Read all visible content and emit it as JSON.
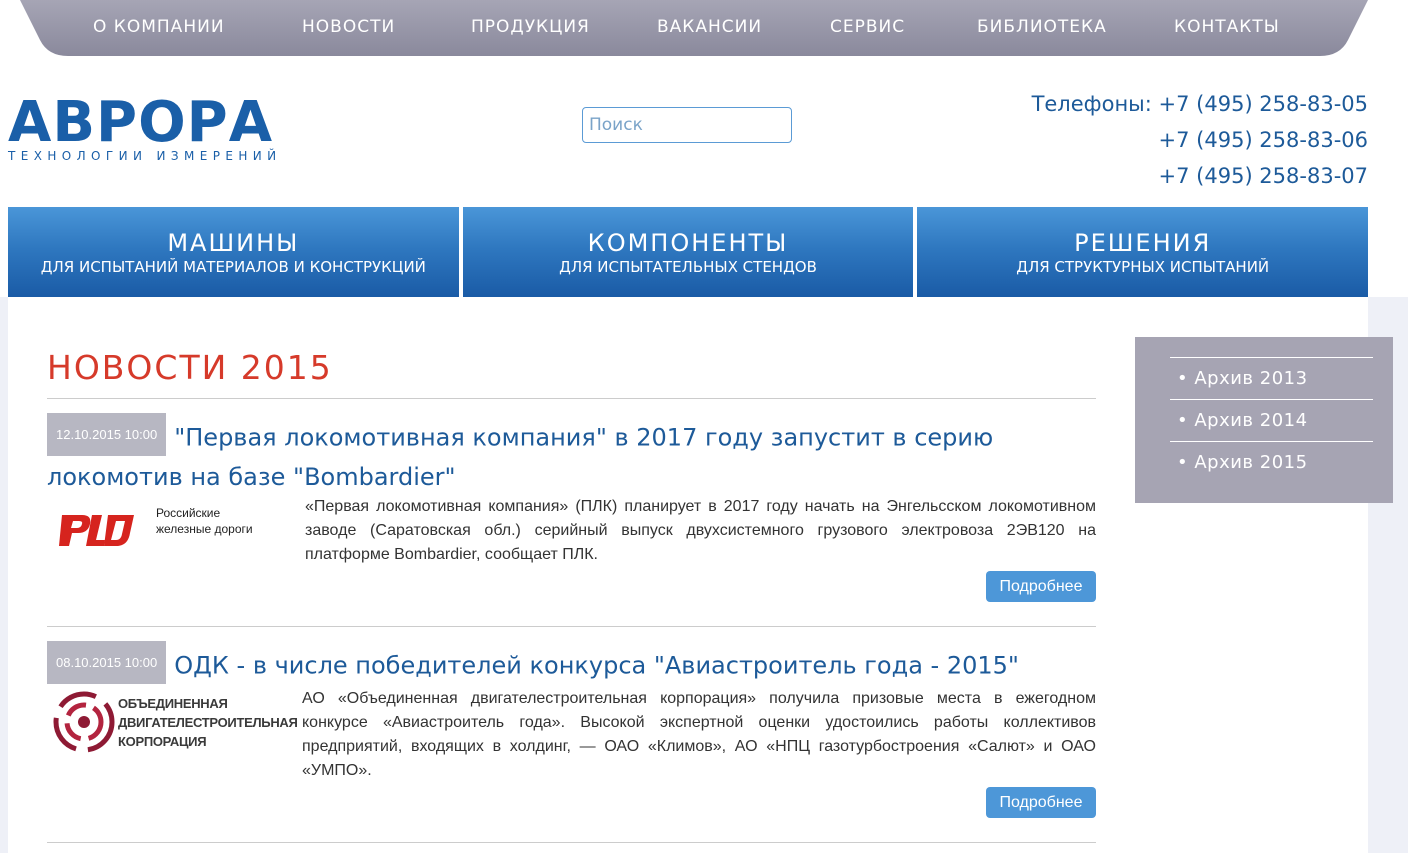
{
  "topnav": {
    "items": [
      "О КОМПАНИИ",
      "НОВОСТИ",
      "ПРОДУКЦИЯ",
      "ВАКАНСИИ",
      "СЕРВИС",
      "БИБЛИОТЕКА",
      "КОНТАКТЫ"
    ]
  },
  "logo": {
    "name": "АВРОРА",
    "tagline": "ТЕХНОЛОГИИ ИЗМЕРЕНИЙ"
  },
  "search": {
    "placeholder": "Поиск"
  },
  "phones": {
    "label": "Телефоны:",
    "numbers": [
      "+7 (495) 258-83-05",
      "+7 (495) 258-83-06",
      "+7 (495) 258-83-07"
    ]
  },
  "categories": [
    {
      "title": "МАШИНЫ",
      "subtitle": "ДЛЯ ИСПЫТАНИЙ МАТЕРИАЛОВ И КОНСТРУКЦИЙ"
    },
    {
      "title": "КОМПОНЕНТЫ",
      "subtitle": "ДЛЯ ИСПЫТАТЕЛЬНЫХ СТЕНДОВ"
    },
    {
      "title": "РЕШЕНИЯ",
      "subtitle": "ДЛЯ СТРУКТУРНЫХ ИСПЫТАНИЙ"
    }
  ],
  "page": {
    "title": "НОВОСТИ 2015"
  },
  "news": [
    {
      "date": "12.10.2015 10:00",
      "title": "\"Первая локомотивная компания\" в 2017 году запустит в серию локомотив на базе \"Bombardier\"",
      "logo_text_1": "Российские",
      "logo_text_2": "железные дороги",
      "text": "«Первая локомотивная компания» (ПЛК) планирует в 2017 году начать на Энгельсском локомотивном заводе (Саратовская обл.) серийный выпуск двухсистемного грузового электровоза 2ЭВ120 на платформе Bombardier, сообщает ПЛК.",
      "more": "Подробнее"
    },
    {
      "date": "08.10.2015 10:00",
      "title": "ОДК - в числе победителей конкурса \"Авиастроитель года - 2015\"",
      "logo_text_1": "ОБЪЕДИНЕННАЯ",
      "logo_text_2": "ДВИГАТЕЛЕСТРОИТЕЛЬНАЯ",
      "logo_text_3": "КОРПОРАЦИЯ",
      "text": "АО «Объединенная двигателестроительная корпорация» получила призовые места в ежегодном конкурсе «Авиастроитель года». Высокой экспертной оценки удостоились работы коллективов предприятий, входящих в холдинг, — ОАО «Климов», АО «НПЦ газотурбостроения «Салют» и ОАО «УМПО».",
      "more": "Подробнее"
    }
  ],
  "sidebar": {
    "items": [
      "• Архив 2013",
      "• Архив 2014",
      "• Архив 2015"
    ]
  },
  "colors": {
    "brand_blue": "#1a5fa8",
    "title_red": "#d63a2a",
    "button_blue": "#4d97d8",
    "nav_gray": "#8f8ea1",
    "sidebar_gray": "#a6a4b3"
  }
}
